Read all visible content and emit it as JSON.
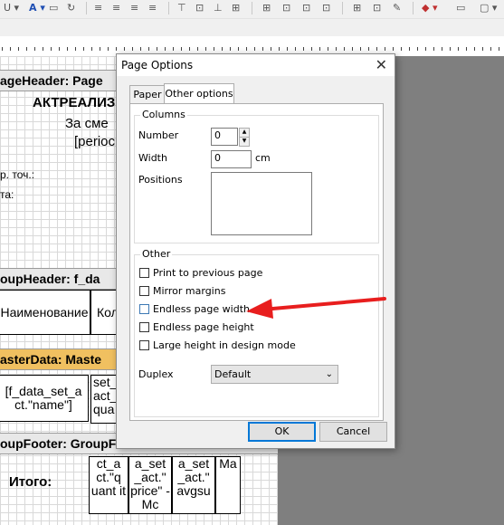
{
  "dialog": {
    "title": "Page Options",
    "close_symbol": "✕",
    "tabs": [
      "Paper",
      "Other options"
    ],
    "columns": {
      "group_label": "Columns",
      "number_label": "Number",
      "number_value": "0",
      "width_label": "Width",
      "width_value": "0",
      "width_unit": "cm",
      "positions_label": "Positions"
    },
    "other": {
      "group_label": "Other",
      "checkboxes": [
        {
          "label": "Print to previous page",
          "checked": false
        },
        {
          "label": "Mirror margins",
          "checked": false
        },
        {
          "label": "Endless page width",
          "checked": false
        },
        {
          "label": "Endless page height",
          "checked": false
        },
        {
          "label": "Large height in design mode",
          "checked": false
        }
      ],
      "duplex_label": "Duplex",
      "duplex_value": "Default"
    },
    "ok_label": "OK",
    "cancel_label": "Cancel"
  },
  "report": {
    "page_header_band": "ageHeader: Page",
    "title_text": "АКТРЕАЛИЗ",
    "shift_text": "За сме",
    "period_text": "[perioc",
    "point_text": "р. точ.:",
    "ta_text": "та:",
    "group_header_band": "oupHeader: f_da",
    "col1_header": "Наименование",
    "col2_header": "Кол",
    "master_data_band": "asterData: Maste",
    "data_cell_1": "[f_data_set_a ct.\"name\"]",
    "data_cell_2": "set_ act_ qua",
    "group_footer_band": "oupFooter: GroupFooter",
    "total_label": "Итого:",
    "footer_cell_1": "ct_a ct.\"q uant it",
    "footer_cell_2": "a_set _act.\" price\" - Mc",
    "footer_cell_3": "a_set _act.\" avgsu",
    "footer_cell_4": "Ma"
  },
  "colors": {
    "annotation_arrow": "#e81e1e",
    "master_band": "#f0c060",
    "dialog_accent": "#0078d7"
  }
}
